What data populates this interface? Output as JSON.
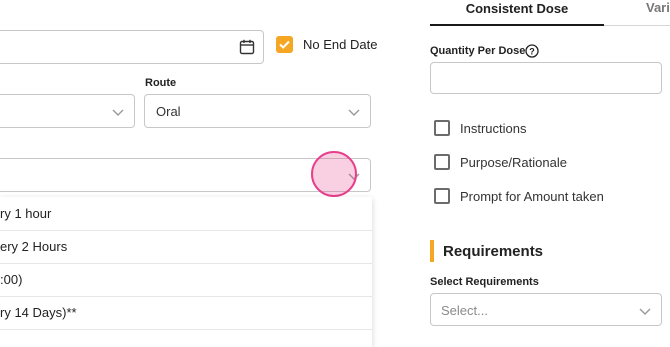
{
  "schedule": {
    "no_end_date_label": "No End Date",
    "no_end_date_checked": true,
    "route_label": "Route",
    "route_value": "Oral",
    "dropdown_options": [
      "ry 1 hour",
      "ery 2 Hours",
      ":00)",
      "ry 14 Days)**",
      "."
    ]
  },
  "dose_panel": {
    "tabs": [
      "Consistent Dose",
      "Vari"
    ],
    "active_tab": 0,
    "quantity_label": "Quantity Per Dose",
    "quantity_help_icon": "question-circle-icon",
    "checkboxes": [
      "Instructions",
      "Purpose/Rationale",
      "Prompt for Amount taken"
    ],
    "requirements_heading": "Requirements",
    "select_requirements_label": "Select Requirements",
    "select_placeholder": "Select..."
  },
  "colors": {
    "accent": "#F5A623",
    "tab_underline": "#1a1a1a",
    "touch_indicator": "#E83E8C"
  }
}
